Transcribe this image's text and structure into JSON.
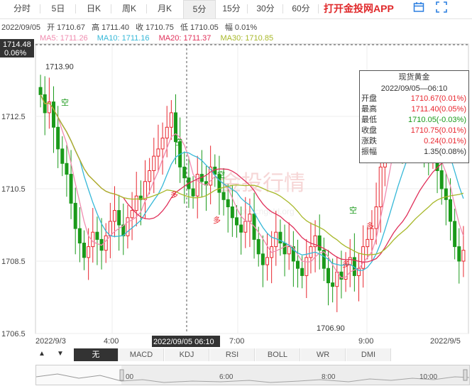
{
  "tabs": [
    "分时",
    "5日",
    "日K",
    "周K",
    "月K",
    "5分",
    "15分",
    "30分",
    "60分"
  ],
  "active_tab": 5,
  "brand": "打开金投网APP",
  "icons": [
    "calendar-icon",
    "fullscreen-icon"
  ],
  "info": {
    "date": "2022/09/05",
    "open": "开 1710.67",
    "high": "高 1711.40",
    "close": "收 1710.75",
    "low": "低 1710.05",
    "amp": "幅 0.01%"
  },
  "ma": {
    "ma5": "MA5: 1711.26",
    "ma10": "MA10: 1711.16",
    "ma20": "MA20: 1711.37",
    "ma30": "MA30: 1710.85"
  },
  "colors": {
    "up": "#e8262e",
    "down": "#1a9a1a",
    "ma5": "#f08cb0",
    "ma10": "#35b8d8",
    "ma20": "#e0305a",
    "ma30": "#a8b82a",
    "crosshair": "#555555"
  },
  "price_label": {
    "value": "1714.48",
    "pct": "0.06%"
  },
  "extremes": {
    "high_label": "1713.90",
    "low_label": "1706.90"
  },
  "crosshair_time": "2022/09/05 06:10",
  "tooltip": {
    "title": "现货黄金",
    "date": "2022/09/05—06:10",
    "rows": [
      {
        "label": "开盘",
        "value": "1710.67(0.01%)",
        "color": "#e8262e"
      },
      {
        "label": "最高",
        "value": "1711.40(0.05%)",
        "color": "#e8262e"
      },
      {
        "label": "最低",
        "value": "1710.05(-0.03%)",
        "color": "#1a9a1a"
      },
      {
        "label": "收盘",
        "value": "1710.75(0.01%)",
        "color": "#e8262e"
      },
      {
        "label": "涨跌",
        "value": "0.24(0.01%)",
        "color": "#e8262e"
      },
      {
        "label": "振幅",
        "value": "1.35(0.08%)",
        "color": "#333333"
      }
    ]
  },
  "indicator_tabs": [
    "无",
    "MACD",
    "KDJ",
    "RSI",
    "BOLL",
    "WR",
    "DMI"
  ],
  "active_indicator": 0,
  "nav": {
    "up": "▲",
    "down": "▼"
  },
  "scroll_times": [
    "00",
    "6:00",
    "8:00",
    "10:00"
  ],
  "chart_data": {
    "type": "candlestick",
    "y_ticks": [
      "1712.5",
      "1710.5",
      "1708.5",
      "1706.5"
    ],
    "ylim": [
      1706.5,
      1714.5
    ],
    "x_ticks": [
      "2022/9/3",
      "4:00",
      "7:00",
      "9:00",
      "2022/9/5"
    ],
    "signals": [
      "空",
      "多"
    ],
    "watermark": "金投行情",
    "watermark_sub": "quote.cngold.org"
  }
}
